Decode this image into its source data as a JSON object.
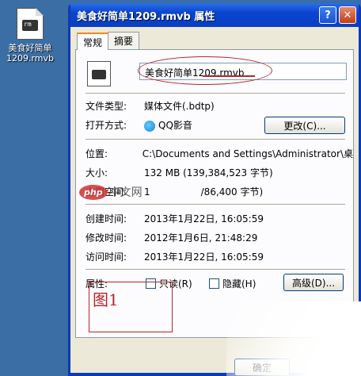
{
  "desktop": {
    "file_label_line1": "美食好简单",
    "file_label_line2": "1209.rmvb"
  },
  "window": {
    "title": "美食好简单1209.rmvb 属性",
    "help_glyph": "?",
    "close_glyph": "✕"
  },
  "tabs": [
    {
      "label": "常规"
    },
    {
      "label": "摘要"
    }
  ],
  "general": {
    "file_name": "美食好简单1209.rmvb",
    "type_label": "文件类型:",
    "type_value": "媒体文件(.bdtp)",
    "open_with_label": "打开方式:",
    "open_with_value": "QQ影音",
    "change_button": "更改(C)...",
    "location_label": "位置:",
    "location_value": "C:\\Documents and Settings\\Administrator\\桌",
    "size_label": "大小:",
    "size_value": "132 MB (139,384,523 字节)",
    "size_on_disk_label": "占用空间:",
    "size_on_disk_value": "1",
    "size_on_disk_value_tail": "/86,400 字节)",
    "created_label": "创建时间:",
    "created_value": "2013年1月22日, 16:05:59",
    "modified_label": "修改时间:",
    "modified_value": "2012年1月6日, 21:48:29",
    "accessed_label": "访问时间:",
    "accessed_value": "2013年1月22日, 16:05:59",
    "attributes_label": "属性:",
    "readonly_label": "只读(R)",
    "hidden_label": "隐藏(H)",
    "advanced_button": "高级(D)..."
  },
  "annotation": {
    "figure_label": "图1"
  },
  "watermark": {
    "brand": "php",
    "text": "中文网"
  },
  "footer": {
    "ok_button": "确定"
  }
}
